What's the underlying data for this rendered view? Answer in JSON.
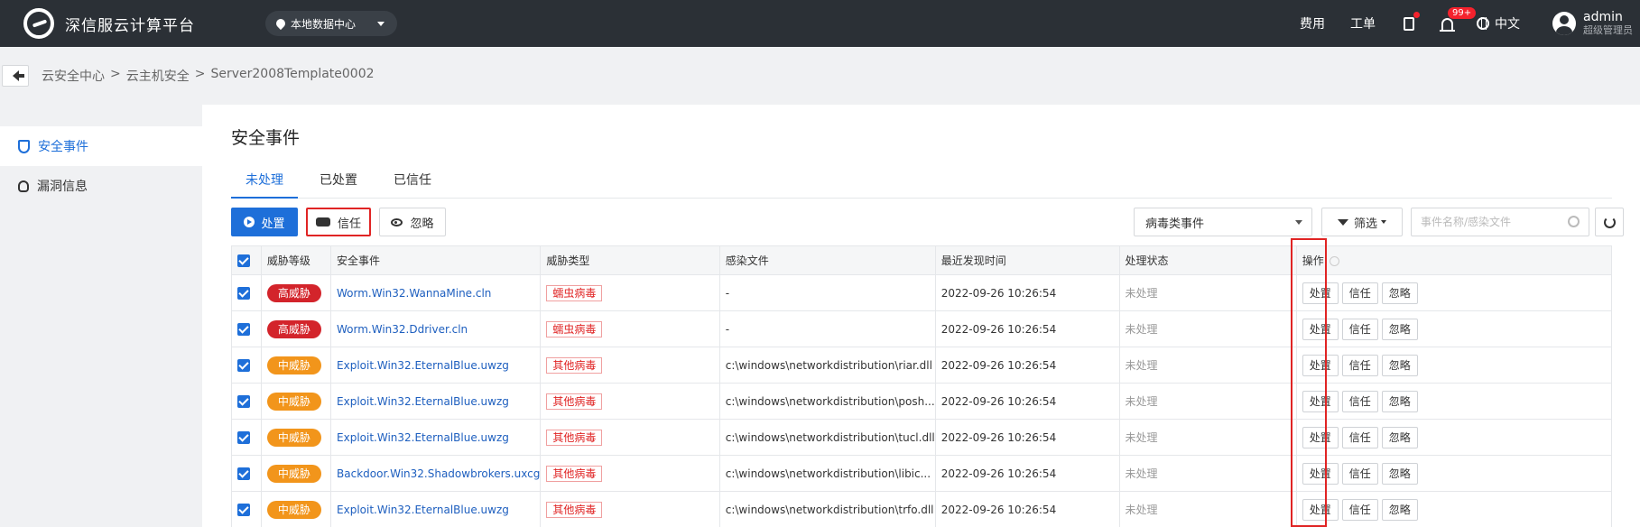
{
  "header": {
    "brand": "深信服云计算平台",
    "datacenter": "本地数据中心",
    "links": {
      "cost": "费用",
      "ticket": "工单"
    },
    "notifications_badge": "99+",
    "language": "中文",
    "user": {
      "name": "admin",
      "role": "超级管理员"
    }
  },
  "breadcrumb": [
    "云安全中心",
    ">",
    "云主机安全",
    ">",
    "Server2008Template0002"
  ],
  "sidebar": {
    "items": [
      {
        "label": "安全事件",
        "icon": "shield-icon",
        "active": true
      },
      {
        "label": "漏洞信息",
        "icon": "bug-icon",
        "active": false
      }
    ]
  },
  "main": {
    "title": "安全事件",
    "tabs": [
      {
        "label": "未处理",
        "active": true
      },
      {
        "label": "已处置",
        "active": false
      },
      {
        "label": "已信任",
        "active": false
      }
    ],
    "toolbar": {
      "handle_label": "处置",
      "trust_label": "信任",
      "ignore_label": "忽略",
      "event_type": "病毒类事件",
      "filter_label": "筛选",
      "search_placeholder": "事件名称/感染文件"
    },
    "table": {
      "headers": [
        "威胁等级",
        "安全事件",
        "威胁类型",
        "感染文件",
        "最近发现时间",
        "处理状态",
        "操作"
      ],
      "op_labels": {
        "handle": "处置",
        "trust": "信任",
        "ignore": "忽略"
      },
      "rows": [
        {
          "level": "高威胁",
          "level_class": "high",
          "event": "Worm.Win32.WannaMine.cln",
          "type": "蠕虫病毒",
          "file": "-",
          "time": "2022-09-26 10:26:54",
          "status": "未处理"
        },
        {
          "level": "高威胁",
          "level_class": "high",
          "event": "Worm.Win32.Ddriver.cln",
          "type": "蠕虫病毒",
          "file": "-",
          "time": "2022-09-26 10:26:54",
          "status": "未处理"
        },
        {
          "level": "中威胁",
          "level_class": "mid",
          "event": "Exploit.Win32.EternalBlue.uwzg",
          "type": "其他病毒",
          "file": "c:\\windows\\networkdistribution\\riar.dll",
          "time": "2022-09-26 10:26:54",
          "status": "未处理"
        },
        {
          "level": "中威胁",
          "level_class": "mid",
          "event": "Exploit.Win32.EternalBlue.uwzg",
          "type": "其他病毒",
          "file": "c:\\windows\\networkdistribution\\posh...",
          "time": "2022-09-26 10:26:54",
          "status": "未处理"
        },
        {
          "level": "中威胁",
          "level_class": "mid",
          "event": "Exploit.Win32.EternalBlue.uwzg",
          "type": "其他病毒",
          "file": "c:\\windows\\networkdistribution\\tucl.dll",
          "time": "2022-09-26 10:26:54",
          "status": "未处理"
        },
        {
          "level": "中威胁",
          "level_class": "mid",
          "event": "Backdoor.Win32.Shadowbrokers.uxcg",
          "type": "其他病毒",
          "file": "c:\\windows\\networkdistribution\\libic...",
          "time": "2022-09-26 10:26:54",
          "status": "未处理"
        },
        {
          "level": "中威胁",
          "level_class": "mid",
          "event": "Exploit.Win32.EternalBlue.uwzg",
          "type": "其他病毒",
          "file": "c:\\windows\\networkdistribution\\trfo.dll",
          "time": "2022-09-26 10:26:54",
          "status": "未处理"
        }
      ]
    }
  },
  "colors": {
    "primary": "#1e6fd9",
    "high": "#d3242b",
    "mid": "#f2951b",
    "header_bg": "#2b3036",
    "highlight": "#e02424"
  }
}
